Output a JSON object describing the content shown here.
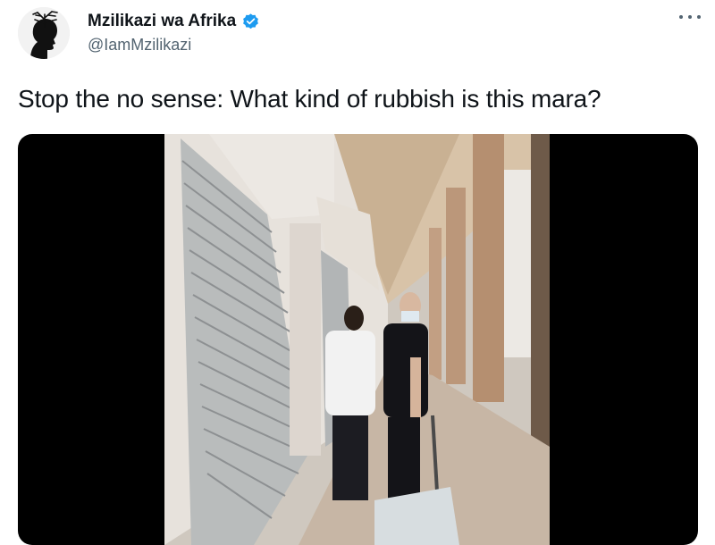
{
  "tweet": {
    "author": {
      "display_name": "Mzilikazi wa Afrika",
      "handle": "@IamMzilikazi",
      "verified": true,
      "avatar_icon": "tree-head-silhouette-avatar"
    },
    "text": "Stop the no sense: What kind of rubbish is this mara?",
    "more_icon": "more-horizontal-icon",
    "media": {
      "type": "video",
      "letterbox_color": "#000000"
    }
  },
  "colors": {
    "text_primary": "#0f1419",
    "text_secondary": "#536471",
    "verified_blue": "#1d9bf0"
  }
}
